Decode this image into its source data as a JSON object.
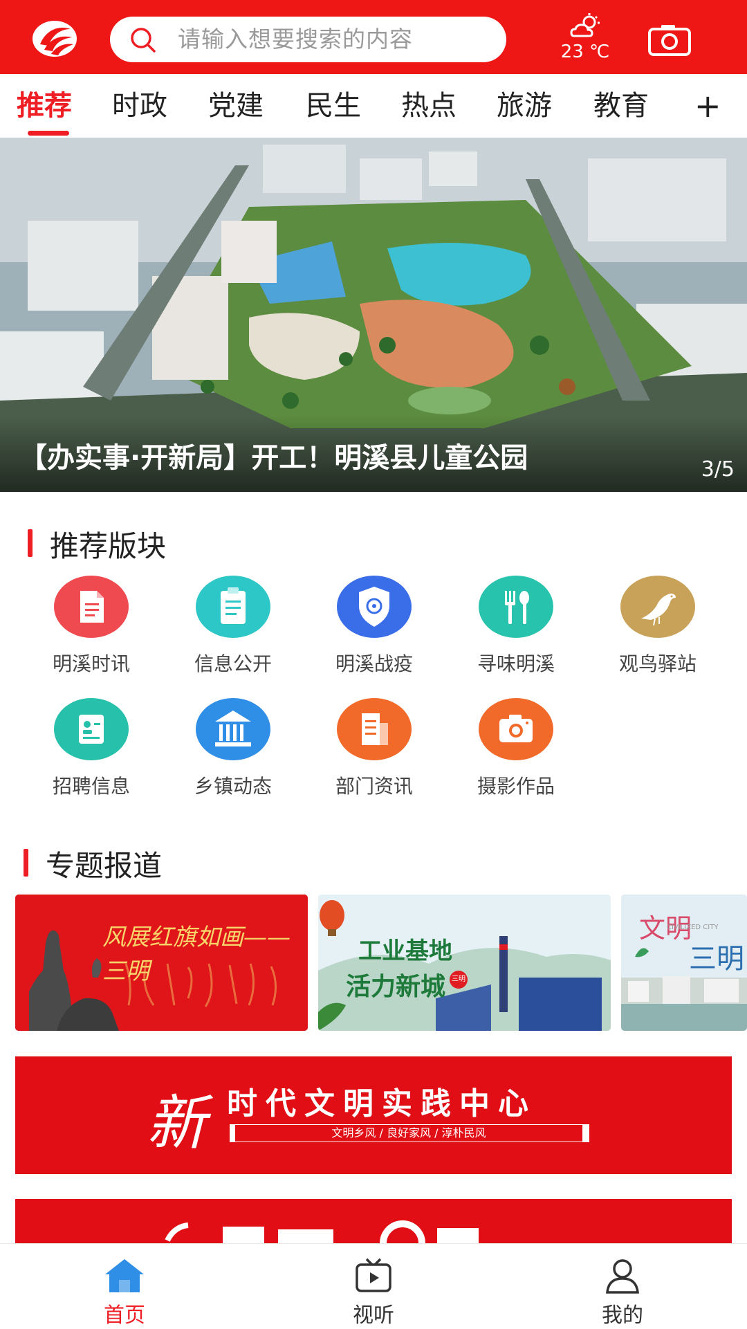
{
  "header": {
    "search_placeholder": "请输入想要搜索的内容",
    "weather_temp": "23 ℃",
    "brand_color": "#ef1616"
  },
  "tabs": {
    "items": [
      {
        "label": "推荐",
        "active": true
      },
      {
        "label": "时政"
      },
      {
        "label": "党建"
      },
      {
        "label": "民生"
      },
      {
        "label": "热点"
      },
      {
        "label": "旅游"
      },
      {
        "label": "教育"
      }
    ],
    "more": "+"
  },
  "banner": {
    "title": "【办实事·开新局】开工！明溪县儿童公园",
    "counter": "3/5"
  },
  "recommended": {
    "title": "推荐版块",
    "modules": [
      {
        "label": "明溪时讯",
        "icon": "document-icon",
        "color": "#ef4a4f"
      },
      {
        "label": "信息公开",
        "icon": "clipboard-icon",
        "color": "#2cc7c6"
      },
      {
        "label": "明溪战疫",
        "icon": "shield-icon",
        "color": "#3a6de8"
      },
      {
        "label": "寻味明溪",
        "icon": "fork-spoon-icon",
        "color": "#27c3ac"
      },
      {
        "label": "观鸟驿站",
        "icon": "bird-icon",
        "color": "#c9a25a"
      },
      {
        "label": "招聘信息",
        "icon": "id-card-icon",
        "color": "#26c0ab"
      },
      {
        "label": "乡镇动态",
        "icon": "building-icon",
        "color": "#2f8ee6"
      },
      {
        "label": "部门资讯",
        "icon": "news-icon",
        "color": "#f26a2a"
      },
      {
        "label": "摄影作品",
        "icon": "camera-icon",
        "color": "#f26a2a"
      }
    ]
  },
  "topics": {
    "title": "专题报道",
    "items": [
      {
        "text": "风展红旗如画——三明"
      },
      {
        "text_line1": "工业基地",
        "text_line2": "活力新城",
        "tag": "三明"
      },
      {
        "text_a": "文明",
        "text_b": "三明",
        "faint": "CIVILIZED CITY"
      }
    ]
  },
  "promo": {
    "main_char": "新",
    "headline": "时代文明实践中心",
    "subline": "文明乡风 / 良好家风 / 淳朴民风"
  },
  "bottom_nav": [
    {
      "label": "首页",
      "icon": "home-icon",
      "active": true
    },
    {
      "label": "视听",
      "icon": "tv-icon"
    },
    {
      "label": "我的",
      "icon": "user-icon"
    }
  ]
}
